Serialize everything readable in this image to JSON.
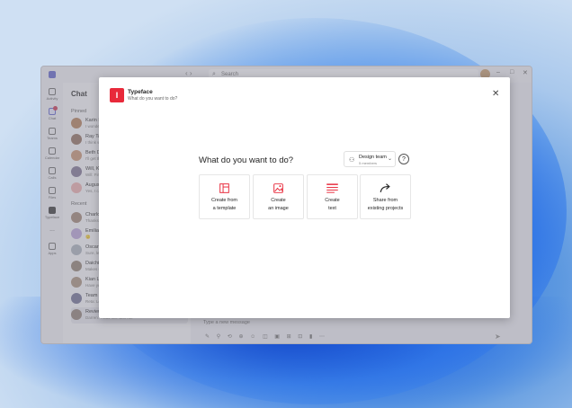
{
  "titlebar": {
    "search_placeholder": "Search",
    "nav_back": "‹",
    "nav_forward": "›",
    "more": "···",
    "min": "–",
    "max": "□",
    "close": "✕"
  },
  "rail": {
    "items": [
      {
        "label": "Activity",
        "icon": "bell-icon"
      },
      {
        "label": "Chat",
        "icon": "chat-icon"
      },
      {
        "label": "Teams",
        "icon": "teams-icon"
      },
      {
        "label": "Calendar",
        "icon": "calendar-icon"
      },
      {
        "label": "Calls",
        "icon": "phone-icon"
      },
      {
        "label": "Files",
        "icon": "file-icon"
      },
      {
        "label": "Typeface",
        "icon": "typeface-icon"
      },
      {
        "label": "...",
        "icon": "more-icon"
      },
      {
        "label": "Apps",
        "icon": "apps-icon"
      }
    ]
  },
  "chatlist": {
    "title": "Chat",
    "pinned_label": "Pinned",
    "recent_label": "Recent",
    "pinned": [
      {
        "name": "Karin I",
        "preview": "I wondered",
        "color": "#b07a55"
      },
      {
        "name": "Ray Ta",
        "preview": "I think we",
        "color": "#8c6a5a"
      },
      {
        "name": "Beth D",
        "preview": "I'll get the",
        "color": "#c48f6e"
      },
      {
        "name": "Will, K",
        "preview": "Will: Fine",
        "color": "#7a6f8f"
      },
      {
        "name": "August",
        "preview": "Yes, I can",
        "color": "#e8a9a9"
      }
    ],
    "recent": [
      {
        "name": "Charlo",
        "preview": "Thanks, I",
        "color": "#9b8070"
      },
      {
        "name": "Emilian",
        "preview": "🙂",
        "color": "#b49fd3"
      },
      {
        "name": "Oscar",
        "preview": "Sure, let",
        "color": "#a6aeb9"
      },
      {
        "name": "Daichi",
        "preview": "Makes sen",
        "color": "#8d7d6d"
      },
      {
        "name": "Kian L",
        "preview": "Have you",
        "color": "#a48c78"
      },
      {
        "name": "Team",
        "preview": "Reta: Let",
        "color": "#6b6b8e"
      },
      {
        "name": "Review",
        "preview": "Darren: Thats fine with me",
        "color": "#8a7a72"
      }
    ]
  },
  "compose": {
    "placeholder": "Type a new message"
  },
  "dialog": {
    "app_name": "Typeface",
    "app_subtitle": "What do you want to do?",
    "logo_glyph": "I",
    "close": "✕",
    "heading": "What do you want to do?",
    "team": {
      "name": "Design team",
      "members": "5 members"
    },
    "help": "?",
    "accent": "#e8293a",
    "cards": [
      {
        "line1": "Create from",
        "line2": "a template",
        "icon": "template-icon"
      },
      {
        "line1": "Create",
        "line2": "an image",
        "icon": "image-icon"
      },
      {
        "line1": "Create",
        "line2": "text",
        "icon": "text-icon"
      },
      {
        "line1": "Share from",
        "line2": "existing projects",
        "icon": "share-icon"
      }
    ]
  }
}
